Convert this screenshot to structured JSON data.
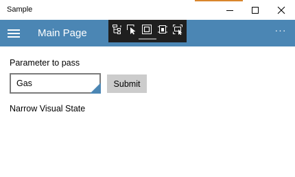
{
  "window": {
    "title": "Sample"
  },
  "header": {
    "title": "Main Page",
    "more_label": "···"
  },
  "main": {
    "parameter_label": "Parameter to pass",
    "parameter_value": "Gas",
    "submit_label": "Submit",
    "visual_state_text": "Narrow Visual State"
  },
  "icons": {
    "menu": "hamburger-icon",
    "minimize": "minimize-icon",
    "maximize": "maximize-icon",
    "close": "close-icon",
    "toolbar": [
      "live-visual-tree-icon",
      "select-element-icon",
      "display-layout-adorners-icon",
      "track-focused-element-icon",
      "display-capture-icon"
    ]
  },
  "colors": {
    "accent": "#4b86b4",
    "toolbar_bg": "#1f1f1f",
    "submit_bg": "#cccccc"
  }
}
